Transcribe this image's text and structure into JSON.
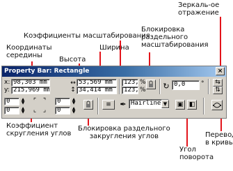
{
  "annotations": {
    "mirror": [
      "Зеркаль-ое",
      "отражение"
    ],
    "scale_factor": "Коэффициенты масштабирования",
    "object_coordinates": [
      "Координаты",
      "середины"
    ],
    "height": "Высота",
    "width": "Ширина",
    "rounding_lock": [
      "Блокировка",
      "раздельного",
      "масштабирования"
    ],
    "corner_rounding": [
      "Коэффициент",
      "скругления углов"
    ],
    "rounding_lock_corners": [
      "Блокировка раздельного",
      "закругления углов"
    ],
    "rotation_angle": [
      "Угол",
      "поворота"
    ],
    "convert_to_curves": [
      "Перевод",
      "в кривые"
    ]
  },
  "toolbar": {
    "title": "Property Bar: Rectangle",
    "close_glyph": "×",
    "x_label": "x:",
    "x_value": "98,303 mm",
    "y_label": "y:",
    "y_value": "215,969 mm",
    "width_value": "53,569 mm",
    "height_value": "34,414 mm",
    "scale_x_value": "123,0",
    "scale_y_value": "123,0",
    "percent_sign": "%",
    "rotation_value": "0,0",
    "corner_tl": "0",
    "corner_bl": "0",
    "corner_tr": "0",
    "corner_br": "0",
    "line_style": "Hairline"
  },
  "colors": {
    "callout_line": "#e3141b",
    "title_start": "#0a246a",
    "panel": "#d4d0c8"
  }
}
